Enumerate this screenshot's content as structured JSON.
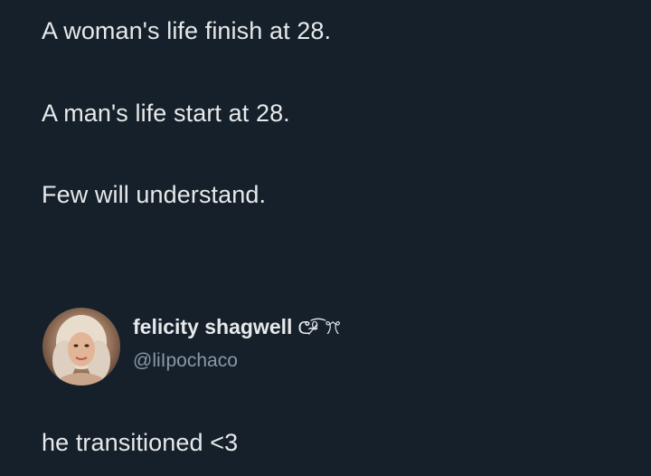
{
  "tweet": {
    "lines": [
      "A woman's life finish at 28.",
      "A man's life start at 28.",
      "Few will understand."
    ]
  },
  "reply": {
    "display_name": "felicity shagwell",
    "name_decoration": "ᕦ⁰̷̴͡ ꔫ",
    "handle": "@liIpochaco",
    "text": "he transitioned <3"
  },
  "colors": {
    "background": "#15202b",
    "text": "#e7e9ea",
    "secondary_text": "#8b98a5"
  }
}
